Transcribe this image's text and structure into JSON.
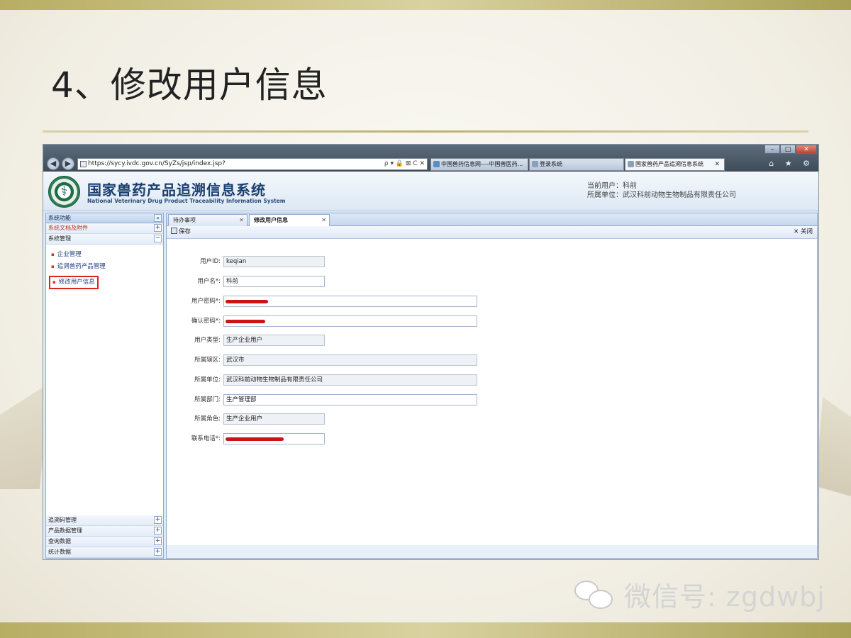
{
  "slide": {
    "title": "4、修改用户信息",
    "watermark": "微信号: zgdwbj"
  },
  "browser": {
    "url": "https://sycy.ivdc.gov.cn/SyZs/jsp/index.jsp?",
    "address_tools": "ρ ▾ 🔒 ⊠ C ✕",
    "tabs": [
      {
        "label": "中国兽药信息网----中国兽医药..."
      },
      {
        "label": "登录系统"
      },
      {
        "label": "国家兽药产品追溯信息系统",
        "close": "✕"
      }
    ],
    "window_controls": {
      "minimize": "–",
      "maximize": "□",
      "close": "✕"
    },
    "tool_icons": "⌂ ★ ⚙"
  },
  "header": {
    "title_cn": "国家兽药产品追溯信息系统",
    "title_en": "National Veterinary Drug Product Traceability Information System",
    "current_user": "当前用户：科前",
    "current_org": "所属单位：武汉科前动物生物制品有限责任公司"
  },
  "sidebar": {
    "heading": "系统功能",
    "collapse": "«",
    "sections_top": [
      {
        "label": "系统文档及附件",
        "toggle": "+",
        "red": true
      },
      {
        "label": "系统管理",
        "toggle": "−",
        "red": false
      }
    ],
    "links": [
      {
        "label": "企业管理"
      },
      {
        "label": "追溯兽药产品管理"
      },
      {
        "label": "修改用户信息"
      }
    ],
    "sections_bottom": [
      {
        "label": "追溯码管理",
        "toggle": "+"
      },
      {
        "label": "产品数据管理",
        "toggle": "+"
      },
      {
        "label": "查询数据",
        "toggle": "+"
      },
      {
        "label": "统计数据",
        "toggle": "+"
      }
    ]
  },
  "main": {
    "tabs": [
      {
        "label": "待办事项",
        "close": "✕"
      },
      {
        "label": "修改用户信息",
        "close": "✕"
      }
    ],
    "save_label": "保存",
    "close_label": "✕ 关闭"
  },
  "form": {
    "fields": [
      {
        "label": "用户ID:",
        "value": "keqian"
      },
      {
        "label": "用户名*:",
        "value": "科前"
      },
      {
        "label": "用户密码*:",
        "value": ""
      },
      {
        "label": "确认密码*:",
        "value": ""
      },
      {
        "label": "用户类型:",
        "value": "生产企业用户"
      },
      {
        "label": "所属辖区:",
        "value": "武汉市"
      },
      {
        "label": "所属单位:",
        "value": "武汉科前动物生物制品有限责任公司"
      },
      {
        "label": "所属部门:",
        "value": "生产管理部"
      },
      {
        "label": "所属角色:",
        "value": "生产企业用户"
      },
      {
        "label": "联系电话*:",
        "value": ""
      }
    ]
  },
  "colors": {
    "accent": "#1a3e6e",
    "highlight_box": "#d8261c",
    "redaction": "#cc1414"
  }
}
